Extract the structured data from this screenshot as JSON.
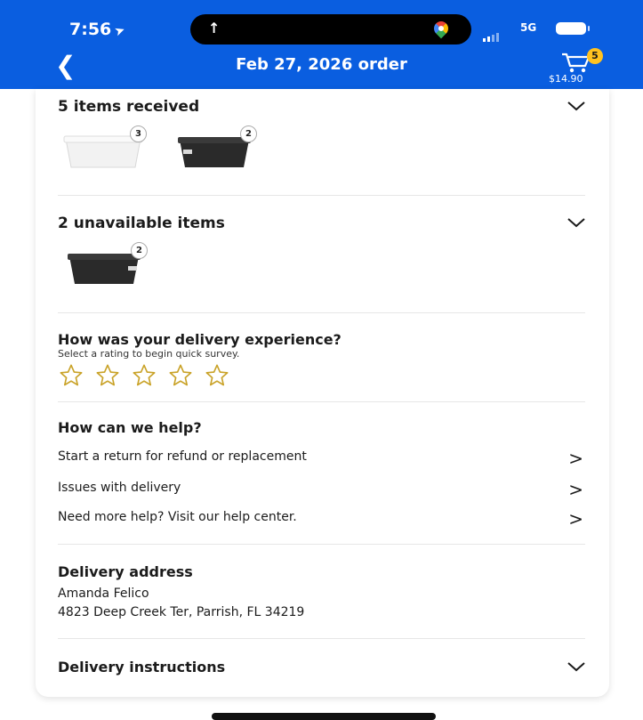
{
  "status_bar": {
    "time": "7:56",
    "network": "5G"
  },
  "header": {
    "title": "Feb 27, 2026 order",
    "cart_count": "5",
    "cart_total": "$14.90"
  },
  "received": {
    "title": "5 items received",
    "items": [
      {
        "color": "#eeeeee",
        "qty": "3"
      },
      {
        "color": "#2a2a2a",
        "qty": "2"
      }
    ]
  },
  "unavailable": {
    "title": "2 unavailable items",
    "items": [
      {
        "color": "#2a2a2a",
        "qty": "2"
      }
    ]
  },
  "survey": {
    "question": "How was your delivery experience?",
    "subtitle": "Select a rating to begin quick survey.",
    "max_stars": 5,
    "rating": 0,
    "star_color": "#c9a227"
  },
  "help": {
    "title": "How can we help?",
    "links": [
      "Start a return for refund or replacement",
      "Issues with delivery",
      "Need more help? Visit our help center."
    ]
  },
  "address": {
    "title": "Delivery address",
    "name": "Amanda Felico",
    "street": "4823 Deep Creek Ter, Parrish, FL 34219"
  },
  "instructions": {
    "title": "Delivery instructions"
  },
  "colors": {
    "brand_blue": "#0a5ee0",
    "badge_yellow": "#ffc220"
  }
}
